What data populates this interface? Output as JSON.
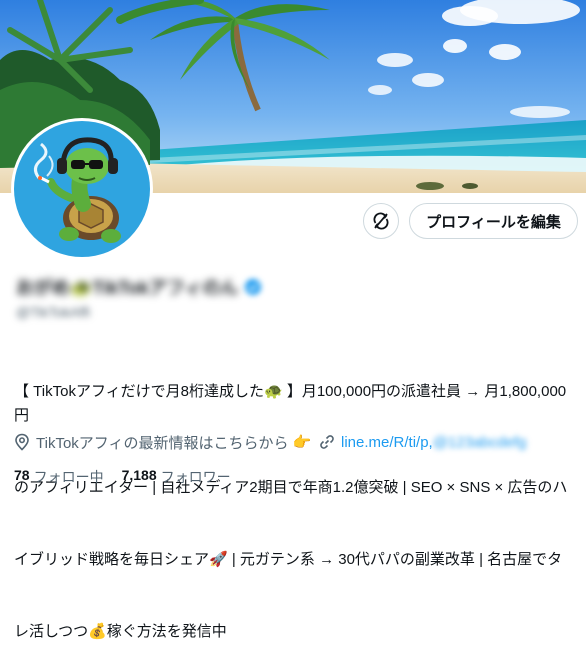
{
  "profile": {
    "display_name": "おがめ🐢TikTokアフィのん",
    "handle": "@TikTokAffi",
    "edit_profile_label": "プロフィールを編集",
    "bio_lines": [
      "【 TikTokアフィだけで月8桁達成した🐢 】月100,000円の派遣社員 → 月1,800,000円",
      "のアフィリエイター | 自社メディア2期目で年商1.2億突破 | SEO × SNS × 広告のハ",
      "イブリッド戦略を毎日シェア🚀 | 元ガテン系 → 30代パパの副業改革 | 名古屋でタ",
      "レ活しつつ💰稼ぐ方法を発信中"
    ],
    "location": "TikTokアフィの最新情報はこちらから",
    "location_emoji": "👉",
    "link_visible": "line.me/R/ti/p,",
    "link_obscured": "@123abcdefg",
    "following_count": "78",
    "following_label": "フォロー中",
    "followers_count": "7,188",
    "followers_label": "フォロワー"
  },
  "icons": {
    "location": "map-pin-icon",
    "link": "link-icon",
    "refresh": "refresh-slash-icon",
    "verified": "verified-badge-icon"
  },
  "colors": {
    "accent": "#1d9bf0",
    "secondary_text": "#536471",
    "border": "#cfd9de",
    "avatar_bg": "#2fa4e0"
  }
}
